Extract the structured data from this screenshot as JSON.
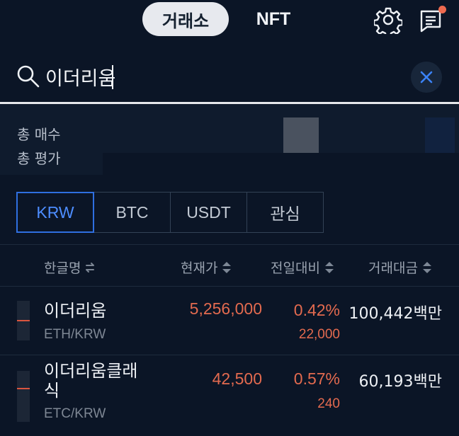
{
  "header": {
    "tabs": [
      {
        "label": "거래소",
        "active": true
      },
      {
        "label": "NFT",
        "active": false
      }
    ],
    "icons": [
      "gear-icon",
      "chat-icon"
    ],
    "notification_dot_color": "#ee6a4f"
  },
  "search": {
    "value": "이더리움",
    "clear_icon": "close-icon"
  },
  "summary": {
    "total_buy_label": "총 매수",
    "total_eval_label": "총 평가"
  },
  "market_tabs": [
    {
      "label": "KRW",
      "active": true
    },
    {
      "label": "BTC",
      "active": false
    },
    {
      "label": "USDT",
      "active": false
    },
    {
      "label": "관심",
      "active": false
    }
  ],
  "columns": {
    "name": "한글명",
    "price": "현재가",
    "change": "전일대비",
    "volume": "거래대금"
  },
  "rows": [
    {
      "name": "이더리움",
      "pair": "ETH/KRW",
      "price": "5,256,000",
      "change_pct": "0.42%",
      "change_abs": "22,000",
      "volume": "100,442백만"
    },
    {
      "name": "이더리움클래\n식",
      "name_line1": "이더리움클래",
      "name_line2": "식",
      "pair": "ETC/KRW",
      "price": "42,500",
      "change_pct": "0.57%",
      "change_abs": "240",
      "volume": "60,193백만"
    }
  ],
  "colors": {
    "background": "#0b1526",
    "accent": "#2f6fe0",
    "rise": "#e36a4f"
  }
}
